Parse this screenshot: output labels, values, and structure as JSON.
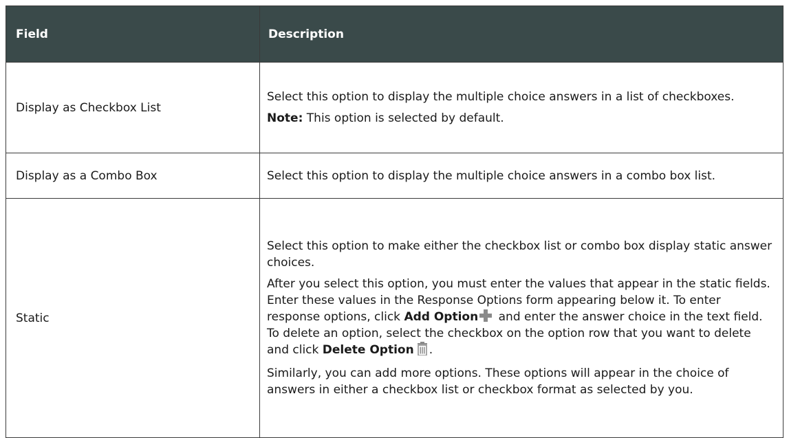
{
  "table": {
    "headers": {
      "field": "Field",
      "description": "Description"
    },
    "rows": [
      {
        "field": "Display as Checkbox List",
        "desc_text": "Select this option to display the multiple choice answers in a list of checkboxes.",
        "note_label": "Note:",
        "note_text": " This option is selected by default."
      },
      {
        "field": "Display as a Combo Box",
        "desc_text": "Select this option to display the multiple choice answers in a combo box list."
      },
      {
        "field": "Static",
        "p1": "Select this option to make either the checkbox list or combo box display static answer choices.",
        "p2_a": "After you select this option, you must enter the values that appear in the static fields. Enter these values in the Response Options form appearing below it. To enter response options, click ",
        "p2_add_option": "Add Option",
        "p2_b": " and enter the answer choice in the text field. To delete an option, select the checkbox on the option row that you want to delete and click ",
        "p2_delete_option": "Delete Option",
        "p2_c": ".",
        "p3": "Similarly, you can add more options. These options will appear in the choice of answers in either a checkbox list or checkbox format as selected by you.",
        "icons": [
          "plus-icon",
          "trash-icon"
        ]
      }
    ]
  },
  "colors": {
    "header_bg": "#3a4a4a",
    "header_text": "#ffffff",
    "icon_gray": "#8a8a8a"
  }
}
